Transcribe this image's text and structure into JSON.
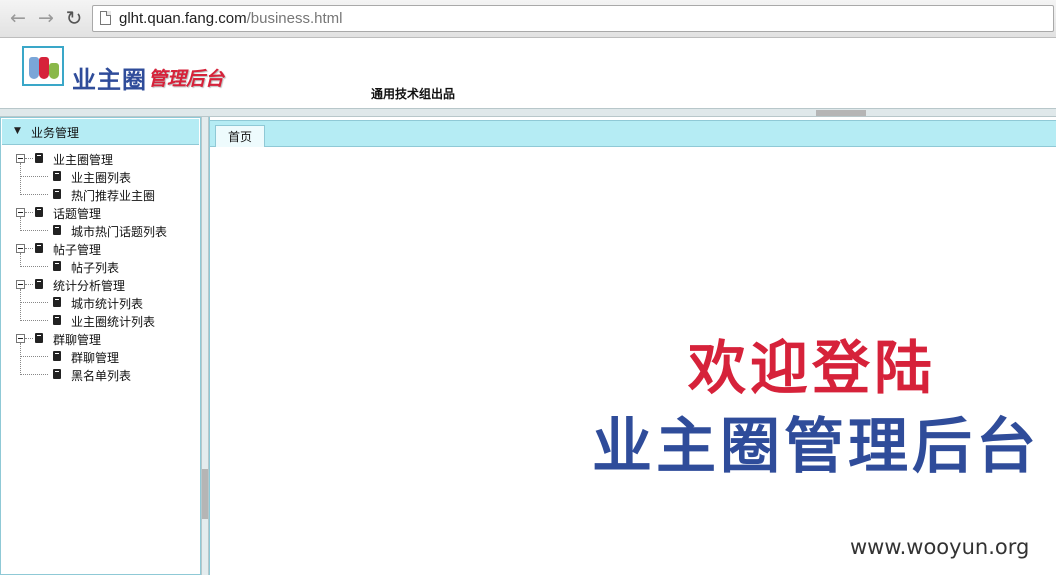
{
  "browser": {
    "back_icon": "arrow-left-icon",
    "forward_icon": "arrow-right-icon",
    "reload_icon": "reload-icon",
    "url_host": "glht.quan.fang.com",
    "url_path": "/business.html"
  },
  "header": {
    "logo_main": "业主圈",
    "logo_sub": "管理后台",
    "tagline": "通用技术组出品"
  },
  "sidebar": {
    "title": "业务管理",
    "groups": [
      {
        "label": "业主圈管理",
        "items": [
          "业主圈列表",
          "热门推荐业主圈"
        ]
      },
      {
        "label": "话题管理",
        "items": [
          "城市热门话题列表"
        ]
      },
      {
        "label": "帖子管理",
        "items": [
          "帖子列表"
        ]
      },
      {
        "label": "统计分析管理",
        "items": [
          "城市统计列表",
          "业主圈统计列表"
        ]
      },
      {
        "label": "群聊管理",
        "items": [
          "群聊管理",
          "黑名单列表"
        ]
      }
    ]
  },
  "main": {
    "tabs": [
      {
        "label": "首页"
      }
    ],
    "welcome_line1": "欢迎登陆",
    "welcome_line2": "业主圈管理后台"
  },
  "watermark": "www.wooyun.org",
  "colors": {
    "accent_cyan": "#b5ecf4",
    "brand_blue": "#2f4c9a",
    "brand_red": "#d6223a"
  }
}
